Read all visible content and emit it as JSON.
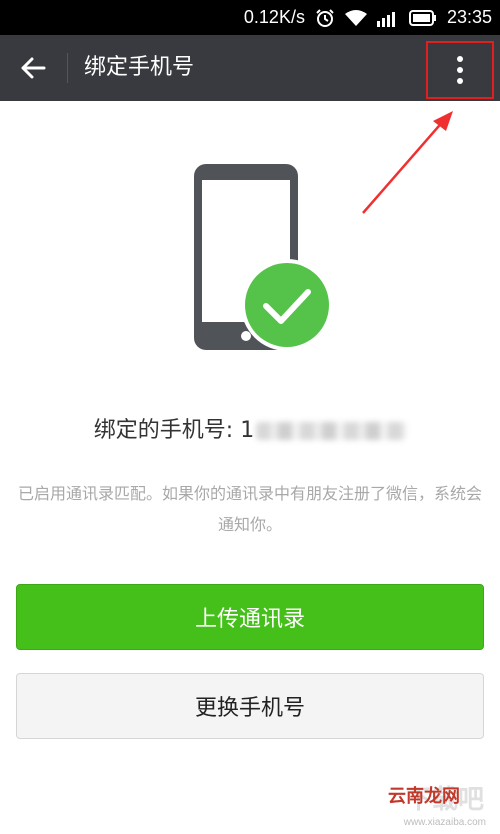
{
  "status_bar": {
    "network_speed": "0.12K/s",
    "time": "23:35",
    "icons": [
      "alarm-icon",
      "wifi-icon",
      "signal-icon",
      "battery-icon"
    ]
  },
  "title_bar": {
    "title": "绑定手机号",
    "back_icon": "back-arrow-icon",
    "more_icon": "more-vertical-icon"
  },
  "content": {
    "bound_label": "绑定的手机号: 1",
    "hint": "已启用通讯录匹配。如果你的通讯录中有朋友注册了微信，系统会通知你。",
    "upload_button": "上传通讯录",
    "change_button": "更换手机号"
  },
  "watermark": {
    "main": "下载吧",
    "site": "云南龙网",
    "url": "www.xiazaiba.com"
  },
  "colors": {
    "accent_green": "#45c01a",
    "title_bar_bg": "#393a3f",
    "highlight_red": "#e02020"
  }
}
